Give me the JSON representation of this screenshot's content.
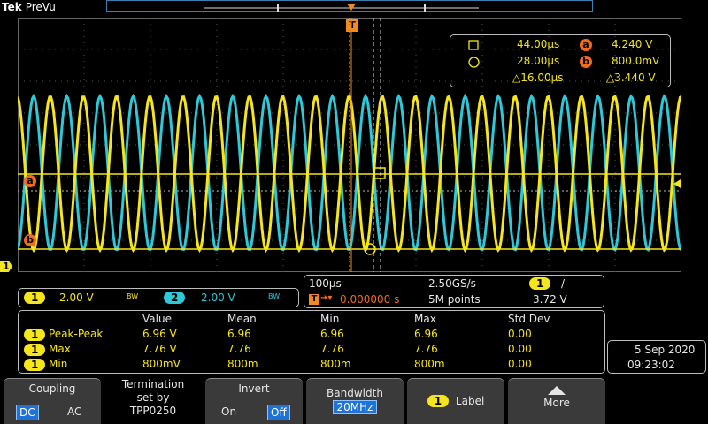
{
  "header": {
    "brand": "Tek",
    "mode": "PreVu"
  },
  "trigger_marker": "T",
  "markers": {
    "a": "a",
    "b": "b",
    "ch1": "1"
  },
  "cursors": {
    "row1": {
      "time": "44.00µs",
      "label": "a",
      "value": "4.240 V"
    },
    "row2": {
      "time": "28.00µs",
      "label": "b",
      "value": "800.0mV"
    },
    "delta": {
      "time": "△16.00µs",
      "value": "△3.440 V"
    }
  },
  "channels": [
    {
      "id": "1",
      "scale": "2.00 V",
      "bw": "BW"
    },
    {
      "id": "2",
      "scale": "2.00 V",
      "bw": "BW"
    }
  ],
  "timebase": {
    "horizontal": "100µs",
    "sample_rate": "2.50GS/s",
    "trigger_channel": "1",
    "trigger_slope": "/",
    "trigger_prefix": "T",
    "trigger_position": "0.000000 s",
    "record_length": "5M points",
    "trigger_level": "3.72 V"
  },
  "measurements": {
    "headers": [
      "Value",
      "Mean",
      "Min",
      "Max",
      "Std Dev"
    ],
    "rows": [
      {
        "ch": "1",
        "name": "Peak-Peak",
        "values": [
          "6.96 V",
          "6.96",
          "6.96",
          "6.96",
          "0.00"
        ]
      },
      {
        "ch": "1",
        "name": "Max",
        "values": [
          "7.76 V",
          "7.76",
          "7.76",
          "7.76",
          "0.00"
        ]
      },
      {
        "ch": "1",
        "name": "Min",
        "values": [
          "800mV",
          "800m",
          "800m",
          "800m",
          "0.00"
        ]
      }
    ]
  },
  "datetime": {
    "date": "5 Sep 2020",
    "time": "09:23:02"
  },
  "softkeys": {
    "coupling": {
      "title": "Coupling",
      "opt1": "DC",
      "opt2": "AC"
    },
    "termination": {
      "line1": "Termination",
      "line2": "set by",
      "line3": "TPP0250"
    },
    "invert": {
      "title": "Invert",
      "opt1": "On",
      "opt2": "Off"
    },
    "bandwidth": {
      "title": "Bandwidth",
      "value": "20MHz"
    },
    "label": {
      "ch": "1",
      "title": "Label"
    },
    "more": {
      "title": "More"
    }
  },
  "colors": {
    "ch1": "#f5e51c",
    "ch2": "#2ec8d8",
    "cursor": "#f26b1d",
    "accent": "#1f73d6"
  }
}
